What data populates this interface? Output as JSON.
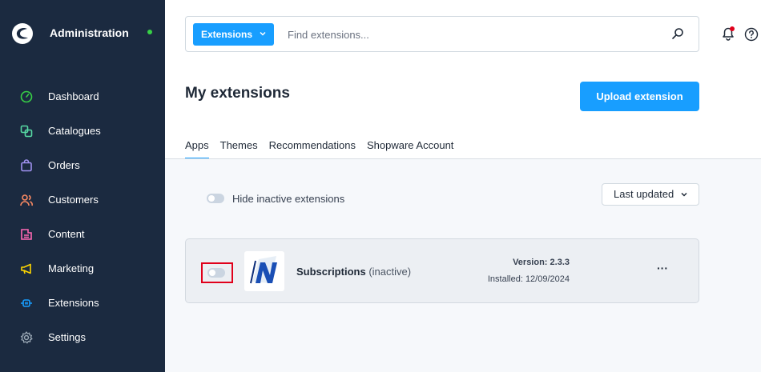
{
  "sidebar": {
    "title": "Administration",
    "items": [
      {
        "label": "Dashboard",
        "icon": "gauge-icon",
        "color": "#37d046"
      },
      {
        "label": "Catalogues",
        "icon": "catalogue-icon",
        "color": "#57d9a3"
      },
      {
        "label": "Orders",
        "icon": "shopping-bag-icon",
        "color": "#a092f0"
      },
      {
        "label": "Customers",
        "icon": "users-icon",
        "color": "#f88962"
      },
      {
        "label": "Content",
        "icon": "content-icon",
        "color": "#ff68b4"
      },
      {
        "label": "Marketing",
        "icon": "megaphone-icon",
        "color": "#ffd700"
      },
      {
        "label": "Extensions",
        "icon": "plug-icon",
        "color": "#189eff"
      },
      {
        "label": "Settings",
        "icon": "gear-icon",
        "color": "#9aa8b5"
      }
    ]
  },
  "search": {
    "scope": "Extensions",
    "placeholder": "Find extensions..."
  },
  "page": {
    "title": "My extensions",
    "upload_label": "Upload extension"
  },
  "tabs": [
    "Apps",
    "Themes",
    "Recommendations",
    "Shopware Account"
  ],
  "filters": {
    "hide_inactive_label": "Hide inactive extensions",
    "sort_label": "Last updated"
  },
  "extension": {
    "name": "Subscriptions",
    "status": "(inactive)",
    "version": "Version: 2.3.3",
    "installed": "Installed: 12/09/2024",
    "more": "···"
  },
  "colors": {
    "accent": "#189eff",
    "sidebar_bg": "#1b2a40",
    "highlight": "#e0001b"
  }
}
